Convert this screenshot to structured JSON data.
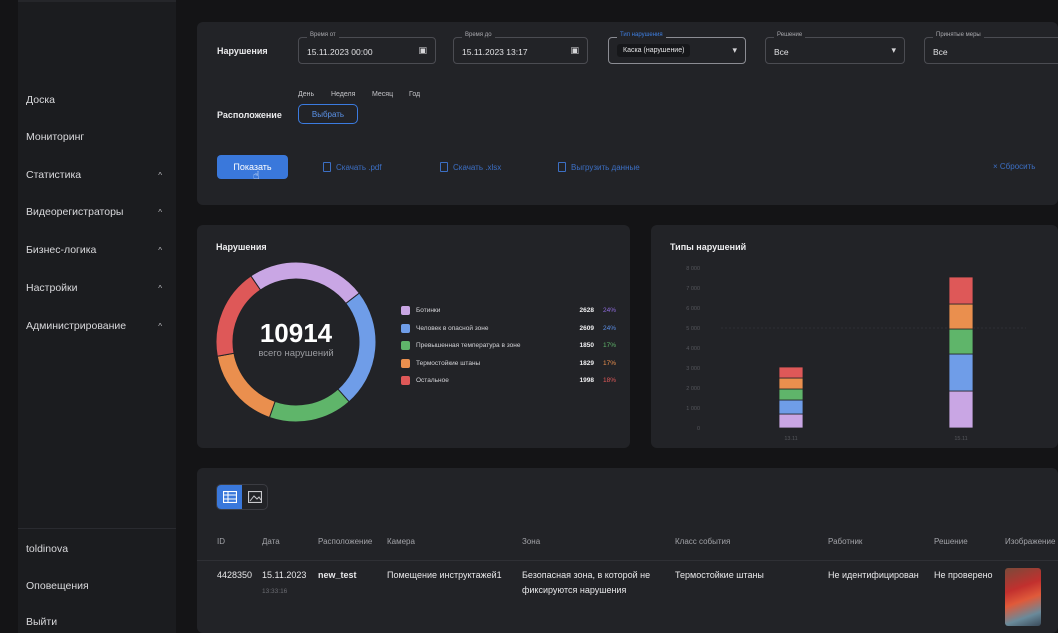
{
  "sidebar": {
    "items": [
      {
        "label": "Доска",
        "expandable": false
      },
      {
        "label": "Мониторинг",
        "expandable": false
      },
      {
        "label": "Статистика",
        "expandable": true
      },
      {
        "label": "Видеорегистраторы",
        "expandable": true
      },
      {
        "label": "Бизнес-логика",
        "expandable": true
      },
      {
        "label": "Настройки",
        "expandable": true
      },
      {
        "label": "Администрирование",
        "expandable": true
      }
    ],
    "chevron": "^",
    "user": "toldinova",
    "notifications": "Оповещения",
    "logout": "Выйти"
  },
  "filters": {
    "violations_label": "Нарушения",
    "time_from": {
      "legend": "Время от",
      "value": "15.11.2023 00:00",
      "icon": "calendar-icon"
    },
    "time_to": {
      "legend": "Время до",
      "value": "15.11.2023 13:17",
      "icon": "calendar-icon"
    },
    "quick_ranges": [
      "День",
      "Неделя",
      "Месяц",
      "Год"
    ],
    "category": {
      "legend": "Тип нарушения",
      "value": "Каска (нарушение)"
    },
    "decision": {
      "legend": "Решение",
      "value": "Все"
    },
    "measures": {
      "legend": "Принятые меры",
      "value": "Все"
    },
    "location_label": "Расположение",
    "select_button": "Выбрать",
    "show_button": "Показать",
    "download_pdf": "Скачать .pdf",
    "download_xlsx": "Скачать .xlsx",
    "export_data": "Выгрузить данные",
    "reset": "× Сбросить"
  },
  "donut": {
    "title": "Нарушения",
    "total": "10914",
    "total_caption": "всего нарушений",
    "legend": [
      {
        "name": "Ботинки",
        "count": "2628",
        "pct": "24%",
        "color": "#c9a6e4",
        "pct_color": "#8e6bdc"
      },
      {
        "name": "Человек в опасной зоне",
        "count": "2609",
        "pct": "24%",
        "color": "#6f9de8",
        "pct_color": "#5b8ee6"
      },
      {
        "name": "Превышенная температура в зоне",
        "count": "1850",
        "pct": "17%",
        "color": "#5fb56a",
        "pct_color": "#5fb56a"
      },
      {
        "name": "Термостойкие штаны",
        "count": "1829",
        "pct": "17%",
        "color": "#ea8f4e",
        "pct_color": "#ea8f4e"
      },
      {
        "name": "Остальное",
        "count": "1998",
        "pct": "18%",
        "color": "#de5858",
        "pct_color": "#de5858"
      }
    ]
  },
  "chart_data": {
    "type": "bar",
    "title": "Типы нарушений",
    "stacked": true,
    "y_ticks": [
      "0",
      "1 000",
      "2 000",
      "3 000",
      "4 000",
      "5 000",
      "6 000",
      "7 000",
      "8 000"
    ],
    "ylim": [
      0,
      8000
    ],
    "categories": [
      "13.11",
      "15.11"
    ],
    "series": [
      {
        "color": "#c9a6e4",
        "values": [
          700,
          1850
        ]
      },
      {
        "color": "#6f9de8",
        "values": [
          700,
          1850
        ]
      },
      {
        "color": "#5fb56a",
        "values": [
          550,
          1250
        ]
      },
      {
        "color": "#ea8f4e",
        "values": [
          550,
          1250
        ]
      },
      {
        "color": "#de5858",
        "values": [
          550,
          1350
        ]
      }
    ]
  },
  "table": {
    "view_icons": [
      "table-icon",
      "image-icon"
    ],
    "headers": [
      "ID",
      "Дата",
      "Расположение",
      "Камера",
      "Зона",
      "Класс события",
      "Работник",
      "Решение",
      "Изображение"
    ],
    "row": {
      "id": "4428350",
      "date": "15.11.2023",
      "time": "13:33:16",
      "location": "new_test",
      "camera": "Помещение инструктажей1",
      "zone": "Безопасная зона, в которой не фиксируются нарушения",
      "event_class": "Термостойкие штаны",
      "worker": "Не идентифицирован",
      "decision": "Не проверено"
    }
  }
}
